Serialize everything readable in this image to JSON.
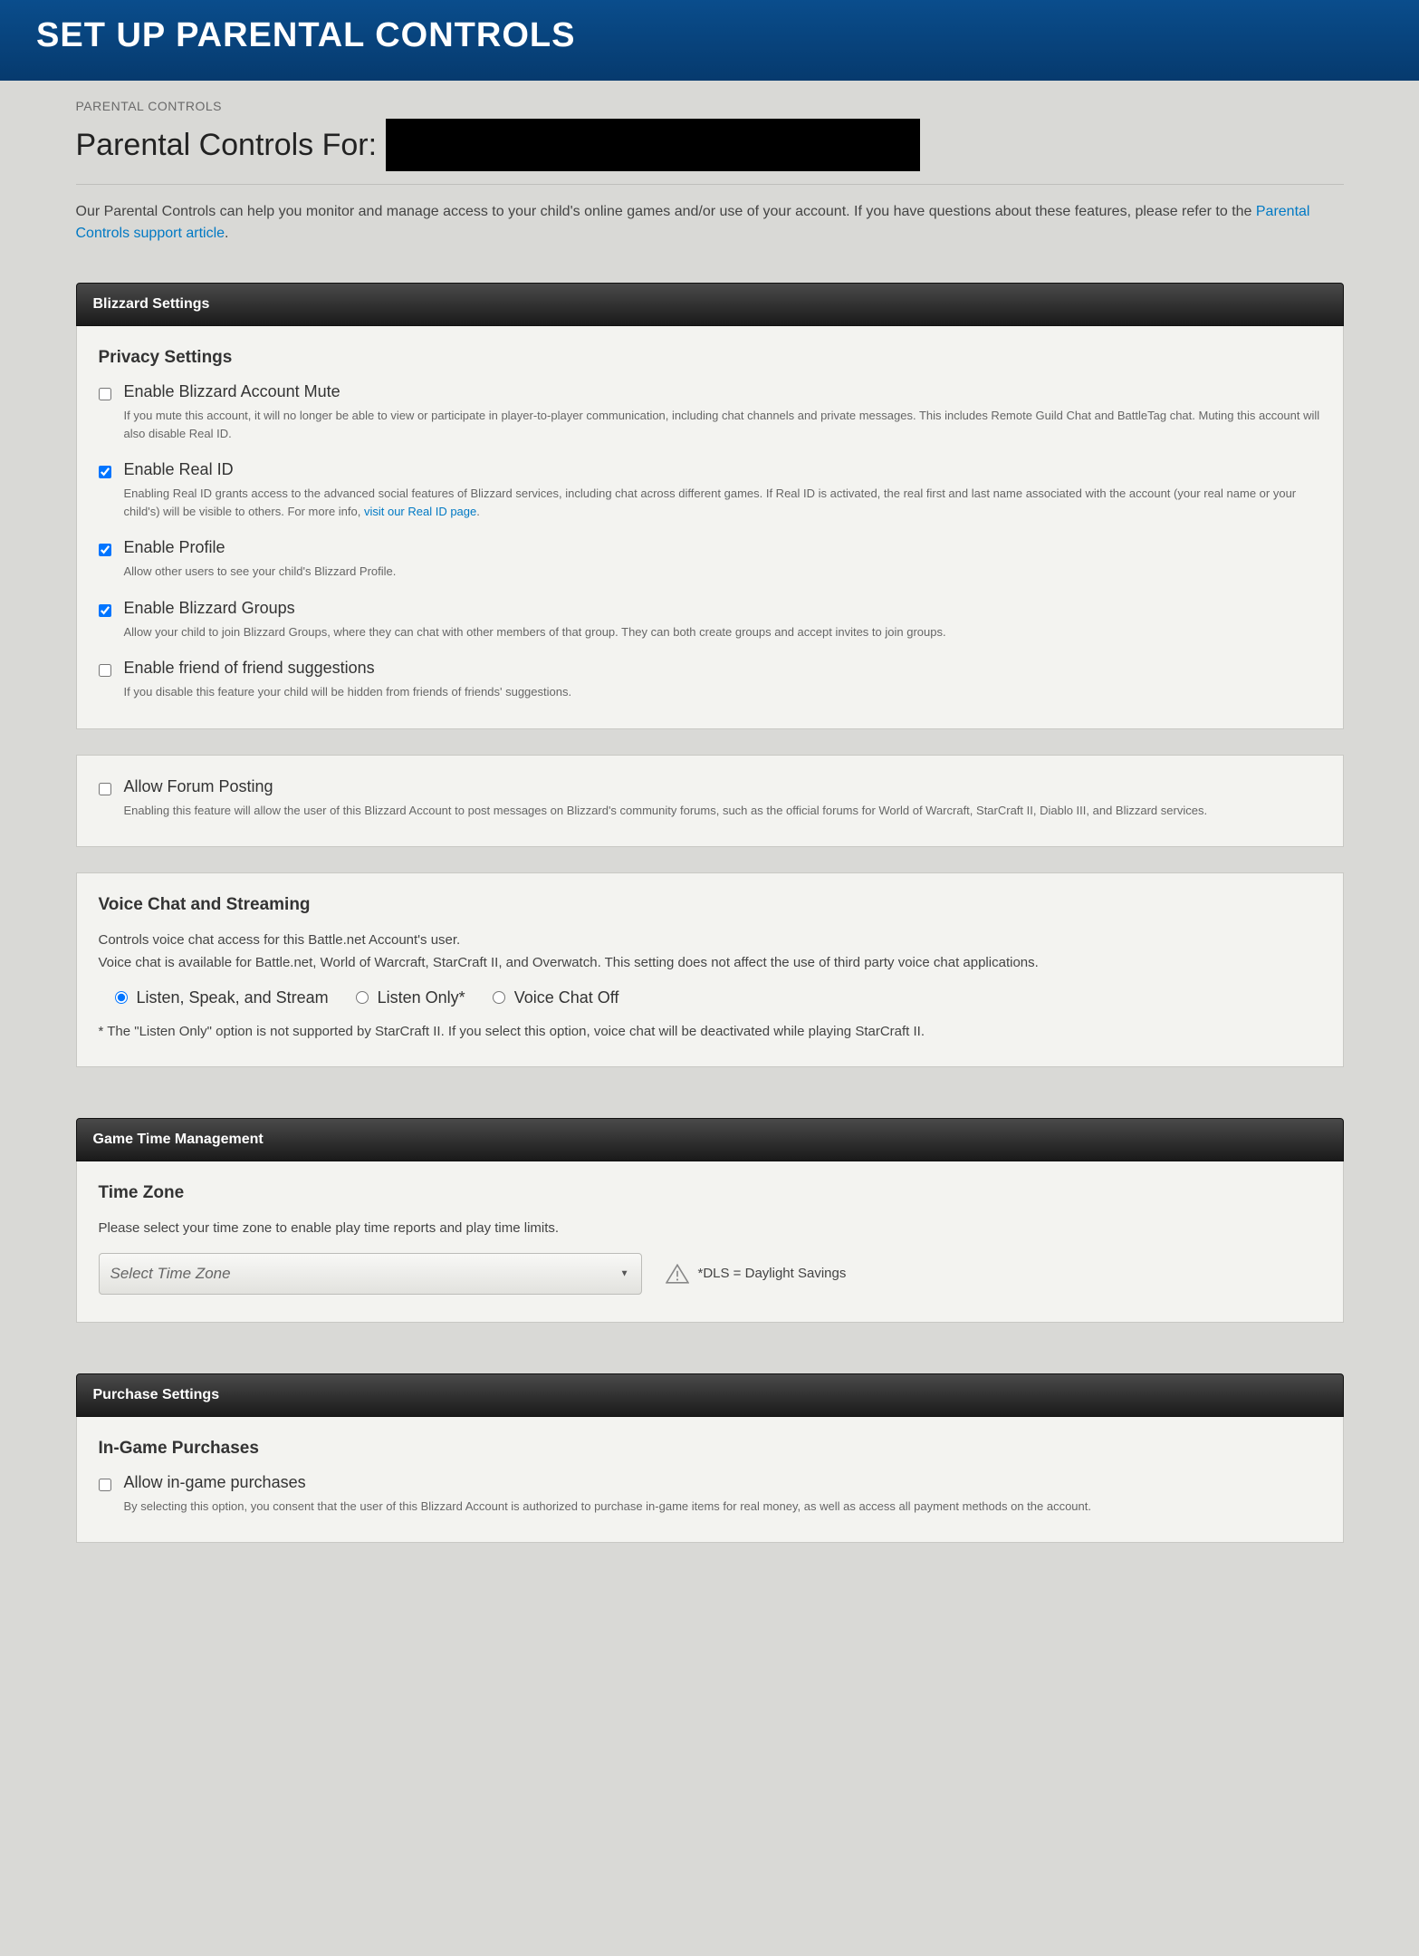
{
  "banner": {
    "title": "SET UP PARENTAL CONTROLS"
  },
  "breadcrumb": "PARENTAL CONTROLS",
  "page_title": "Parental Controls For:",
  "intro": {
    "text_before": "Our Parental Controls can help you monitor and manage access to your child's online games and/or use of your account. If you have questions about these features, please refer to the ",
    "link": "Parental Controls support article",
    "text_after": "."
  },
  "sections": {
    "blizzard": {
      "header": "Blizzard Settings",
      "privacy": {
        "heading": "Privacy Settings",
        "options": [
          {
            "id": "mute",
            "label": "Enable Blizzard Account Mute",
            "checked": false,
            "desc": "If you mute this account, it will no longer be able to view or participate in player-to-player communication, including chat channels and private messages. This includes Remote Guild Chat and BattleTag chat. Muting this account will also disable Real ID."
          },
          {
            "id": "realid",
            "label": "Enable Real ID",
            "checked": true,
            "desc_before": "Enabling Real ID grants access to the advanced social features of Blizzard services, including chat across different games. If Real ID is activated, the real first and last name associated with the account (your real name or your child's) will be visible to others. For more info, ",
            "desc_link": "visit our Real ID page",
            "desc_after": "."
          },
          {
            "id": "profile",
            "label": "Enable Profile",
            "checked": true,
            "desc": "Allow other users to see your child's Blizzard Profile."
          },
          {
            "id": "groups",
            "label": "Enable Blizzard Groups",
            "checked": true,
            "desc": "Allow your child to join Blizzard Groups, where they can chat with other members of that group. They can both create groups and accept invites to join groups."
          },
          {
            "id": "fof",
            "label": "Enable friend of friend suggestions",
            "checked": false,
            "desc": "If you disable this feature your child will be hidden from friends of friends' suggestions."
          }
        ]
      },
      "forum": {
        "label": "Allow Forum Posting",
        "checked": false,
        "desc": "Enabling this feature will allow the user of this Blizzard Account to post messages on Blizzard's community forums, such as the official forums for World of Warcraft, StarCraft II, Diablo III, and Blizzard services."
      },
      "voice": {
        "heading": "Voice Chat and Streaming",
        "desc1": "Controls voice chat access for this Battle.net Account's user.",
        "desc2": "Voice chat is available for Battle.net, World of Warcraft, StarCraft II, and Overwatch. This setting does not affect the use of third party voice chat applications.",
        "options": [
          {
            "id": "vc-full",
            "label": "Listen, Speak, and Stream",
            "checked": true
          },
          {
            "id": "vc-listen",
            "label": "Listen Only*",
            "checked": false
          },
          {
            "id": "vc-off",
            "label": "Voice Chat Off",
            "checked": false
          }
        ],
        "footnote": "* The \"Listen Only\" option is not supported by StarCraft II. If you select this option, voice chat will be deactivated while playing StarCraft II."
      }
    },
    "gametime": {
      "header": "Game Time Management",
      "tz": {
        "heading": "Time Zone",
        "desc": "Please select your time zone to enable play time reports and play time limits.",
        "placeholder": "Select Time Zone",
        "dls_note": "*DLS = Daylight Savings"
      }
    },
    "purchase": {
      "header": "Purchase Settings",
      "ingame": {
        "heading": "In-Game Purchases",
        "label": "Allow in-game purchases",
        "checked": false,
        "desc": "By selecting this option, you consent that the user of this Blizzard Account is authorized to purchase in-game items for real money, as well as access all payment methods on the account."
      }
    }
  }
}
